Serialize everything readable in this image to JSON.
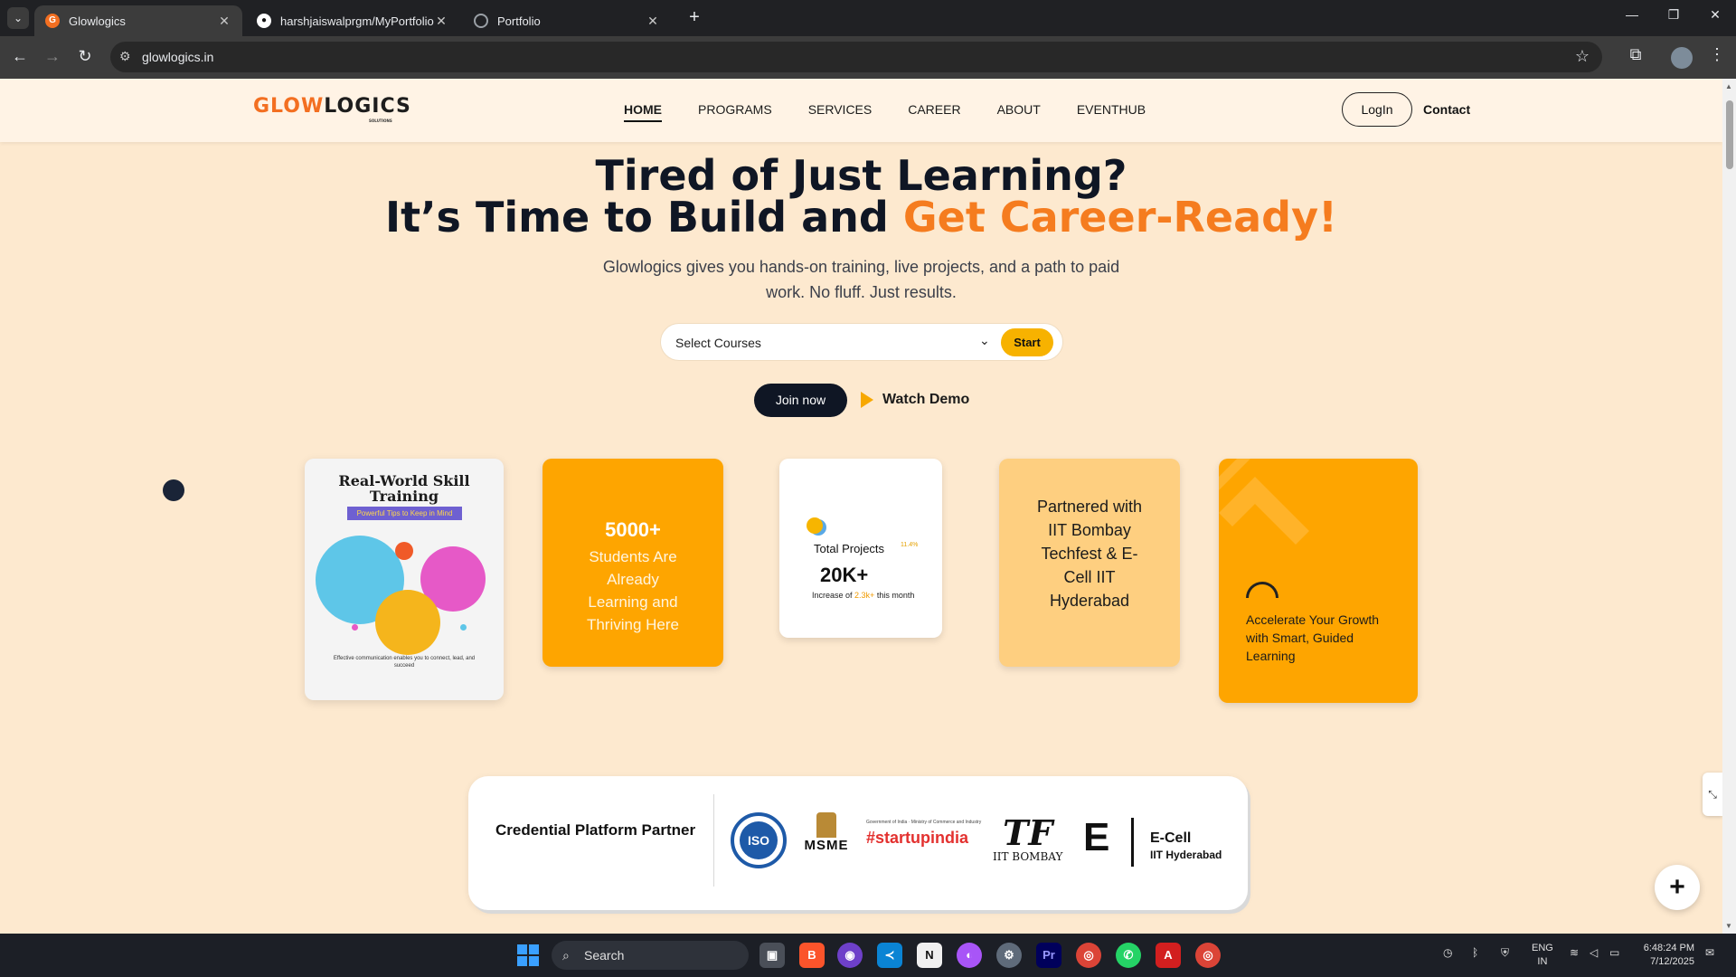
{
  "browser": {
    "tabs": [
      {
        "title": "Glowlogics",
        "favicon_color": "#f36f21",
        "active": true
      },
      {
        "title": "harshjaiswalprgm/MyPortfolio",
        "favicon_color": "#ffffff",
        "active": false
      },
      {
        "title": "Portfolio",
        "favicon_color": "#9aa0a6",
        "active": false
      }
    ],
    "url": "glowlogics.in"
  },
  "site": {
    "logo": {
      "part1": "GLOW",
      "part2": "LOGICS",
      "sub": "SOLUTIONS"
    },
    "nav": [
      "HOME",
      "PROGRAMS",
      "SERVICES",
      "CAREER",
      "ABOUT",
      "EVENTHUB"
    ],
    "login_label": "LogIn",
    "contact_label": "Contact"
  },
  "hero": {
    "line1": "Tired of Just Learning?",
    "line2_prefix": "It’s Time to Build and ",
    "line2_accent": "Get Career-Ready!",
    "subtitle": "Glowlogics gives you hands-on training, live projects, and a path to paid work. No fluff. Just results.",
    "select_placeholder": "Select Courses",
    "start_label": "Start",
    "join_label": "Join now",
    "watch_label": "Watch Demo"
  },
  "cards": {
    "skill": {
      "title": "Real-World Skill Training",
      "badge": "Powerful Tips to Keep in Mind",
      "caption": "Effective communication enables you to connect, lead, and succeed"
    },
    "students": {
      "count": "5000+",
      "text": "Students Are Already Learning and Thriving Here"
    },
    "projects": {
      "label": "Total Projects",
      "growth": "11.4%",
      "value": "20K+",
      "increase_prefix": "Increase of ",
      "increase_value": "2.3k+",
      "increase_suffix": " this month"
    },
    "partnered": {
      "text": "Partnered with IIT Bombay Techfest & E-Cell IIT Hyderabad"
    },
    "accelerate": {
      "text": "Accelerate Your Growth with Smart, Guided Learning"
    }
  },
  "partners": {
    "label": "Credential Platform Partner",
    "iso": "ISO",
    "msme": "MSME",
    "startup_gov": "Government of India · Ministry of Commerce and Industry",
    "startup": "#startupindia",
    "iitb_mark": "TF",
    "iitb_name": "IIT BOMBAY",
    "ecell_mark": "E",
    "ecell_name": "E-Cell",
    "ecell_sub": "IIT Hyderabad"
  },
  "taskbar": {
    "search_placeholder": "Search",
    "lang_line1": "ENG",
    "lang_line2": "IN",
    "time": "6:48:24 PM",
    "date": "7/12/2025"
  },
  "colors": {
    "accent": "#f57c1f",
    "orange": "#fea500",
    "dark": "#0f1624"
  }
}
